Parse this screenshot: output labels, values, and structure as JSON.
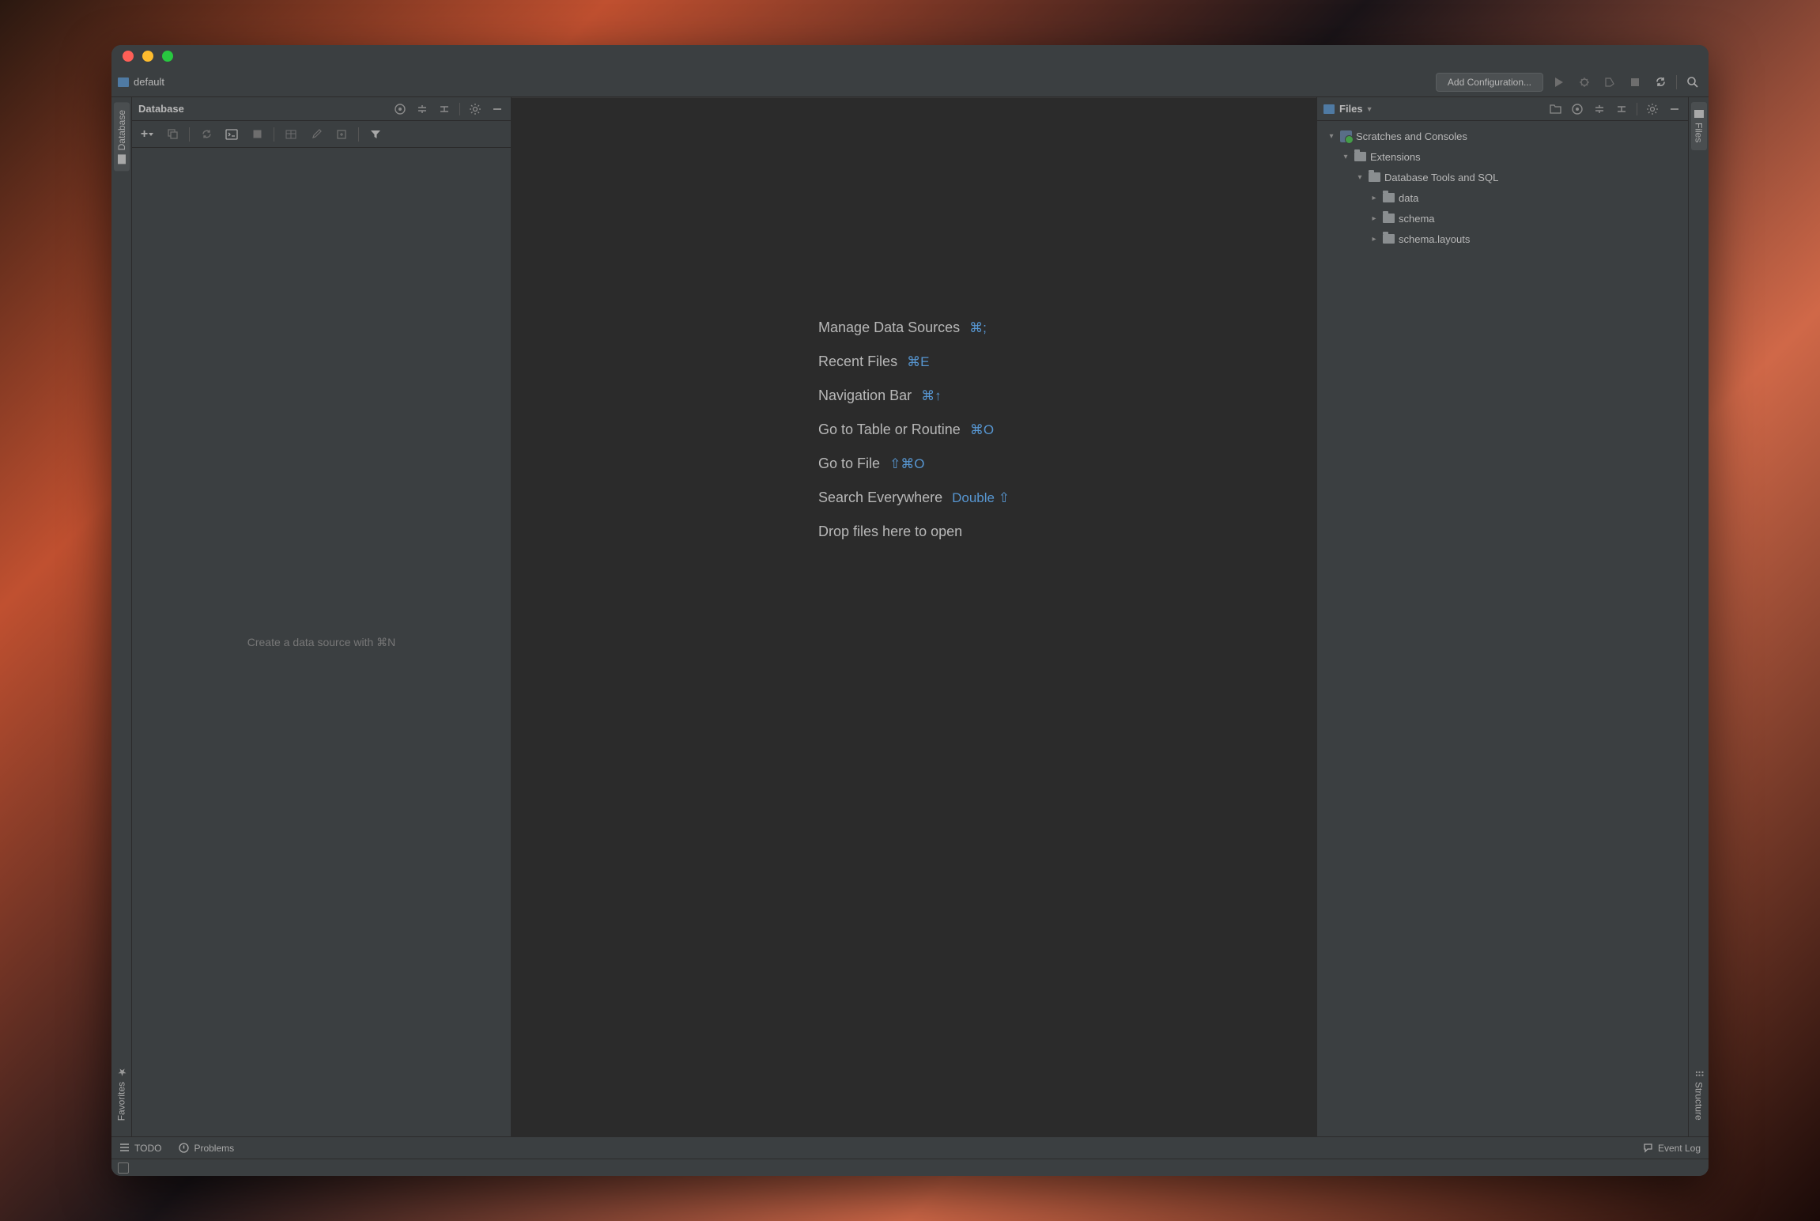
{
  "window": {
    "project_name": "default"
  },
  "toolbar": {
    "config_button": "Add Configuration...",
    "icons": [
      "run",
      "debug",
      "coverage",
      "stop",
      "sync",
      "search"
    ]
  },
  "left_rail": {
    "database_tab": "Database",
    "favorites_tab": "Favorites"
  },
  "right_rail": {
    "files_tab": "Files",
    "structure_tab": "Structure"
  },
  "db_panel": {
    "title": "Database",
    "empty_text": "Create a data source with ⌘N",
    "toolbar_icons": [
      "add",
      "duplicate",
      "refresh",
      "query-console",
      "stop",
      "table",
      "edit",
      "jump",
      "filter"
    ]
  },
  "editor": {
    "hints": [
      {
        "label": "Manage Data Sources",
        "shortcut": "⌘;"
      },
      {
        "label": "Recent Files",
        "shortcut": "⌘E"
      },
      {
        "label": "Navigation Bar",
        "shortcut": "⌘↑"
      },
      {
        "label": "Go to Table or Routine",
        "shortcut": "⌘O"
      },
      {
        "label": "Go to File",
        "shortcut": "⇧⌘O"
      },
      {
        "label": "Search Everywhere",
        "shortcut": "Double ⇧"
      },
      {
        "label": "Drop files here to open",
        "shortcut": ""
      }
    ]
  },
  "files_panel": {
    "title": "Files",
    "tree": {
      "root": "Scratches and Consoles",
      "extensions": "Extensions",
      "db_tools": "Database Tools and SQL",
      "data": "data",
      "schema": "schema",
      "schema_layouts": "schema.layouts"
    }
  },
  "status_bar": {
    "todo": "TODO",
    "problems": "Problems",
    "event_log": "Event Log"
  }
}
